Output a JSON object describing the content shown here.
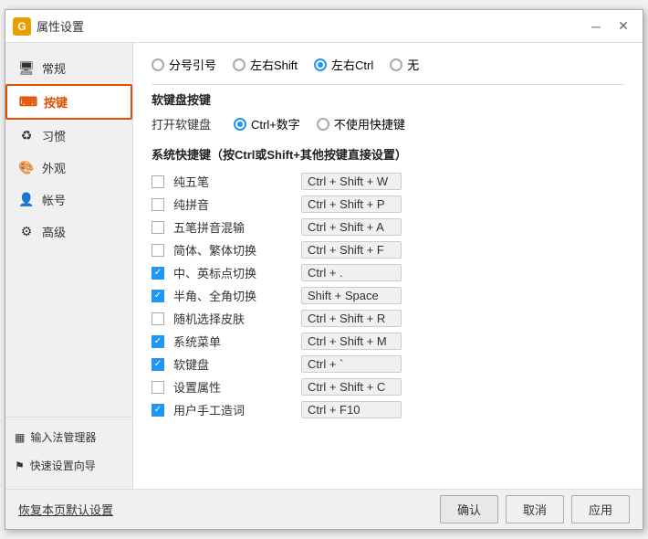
{
  "window": {
    "title": "属性设置",
    "icon": "G",
    "minimize": "─",
    "close": "✕"
  },
  "sidebar": {
    "items": [
      {
        "id": "general",
        "label": "常规",
        "icon": "🖥"
      },
      {
        "id": "keys",
        "label": "按键",
        "icon": "⌨",
        "active": true
      },
      {
        "id": "habits",
        "label": "习惯",
        "icon": "♻"
      },
      {
        "id": "appearance",
        "label": "外观",
        "icon": "🎨"
      },
      {
        "id": "account",
        "label": "帐号",
        "icon": "👤"
      },
      {
        "id": "advanced",
        "label": "高级",
        "icon": "⚙"
      }
    ],
    "bottom": [
      {
        "id": "ime-manager",
        "label": "输入法管理器",
        "icon": "▦"
      },
      {
        "id": "quick-setup",
        "label": "快速设置向导",
        "icon": "⚑"
      }
    ]
  },
  "main": {
    "top_radio": {
      "label": "",
      "options": [
        {
          "id": "semicolon",
          "label": "分号引号",
          "checked": false
        },
        {
          "id": "lr-shift",
          "label": "左右Shift",
          "checked": false
        },
        {
          "id": "lr-ctrl",
          "label": "左右Ctrl",
          "checked": true
        },
        {
          "id": "none",
          "label": "无",
          "checked": false
        }
      ]
    },
    "soft_keyboard": {
      "title": "软键盘按键",
      "label": "打开软键盘",
      "options": [
        {
          "id": "ctrl-num",
          "label": "Ctrl+数字",
          "checked": true
        },
        {
          "id": "no-shortcut",
          "label": "不使用快捷键",
          "checked": false
        }
      ]
    },
    "shortcuts_title": "系统快捷键（按Ctrl或Shift+其他按键直接设置）",
    "shortcuts": [
      {
        "id": "wubi",
        "label": "纯五笔",
        "key": "Ctrl + Shift + W",
        "checked": false
      },
      {
        "id": "pinyin",
        "label": "纯拼音",
        "key": "Ctrl + Shift + P",
        "checked": false
      },
      {
        "id": "mixed",
        "label": "五笔拼音混输",
        "key": "Ctrl + Shift + A",
        "checked": false
      },
      {
        "id": "simplified",
        "label": "简体、繁体切换",
        "key": "Ctrl + Shift + F",
        "checked": false
      },
      {
        "id": "cn-en",
        "label": "中、英标点切换",
        "key": "Ctrl + .",
        "checked": true
      },
      {
        "id": "halfwidth",
        "label": "半角、全角切换",
        "key": "Shift + Space",
        "checked": true
      },
      {
        "id": "random-skin",
        "label": "随机选择皮肤",
        "key": "Ctrl + Shift + R",
        "checked": false
      },
      {
        "id": "sys-menu",
        "label": "系统菜单",
        "key": "Ctrl + Shift + M",
        "checked": true
      },
      {
        "id": "keyboard",
        "label": "软键盘",
        "key": "Ctrl + `",
        "checked": true
      },
      {
        "id": "properties",
        "label": "设置属性",
        "key": "Ctrl + Shift + C",
        "checked": false
      },
      {
        "id": "user-words",
        "label": "用户手工造词",
        "key": "Ctrl + F10",
        "checked": true
      }
    ]
  },
  "footer": {
    "reset_label": "恢复本页默认设置",
    "confirm": "确认",
    "cancel": "取消",
    "apply": "应用"
  }
}
